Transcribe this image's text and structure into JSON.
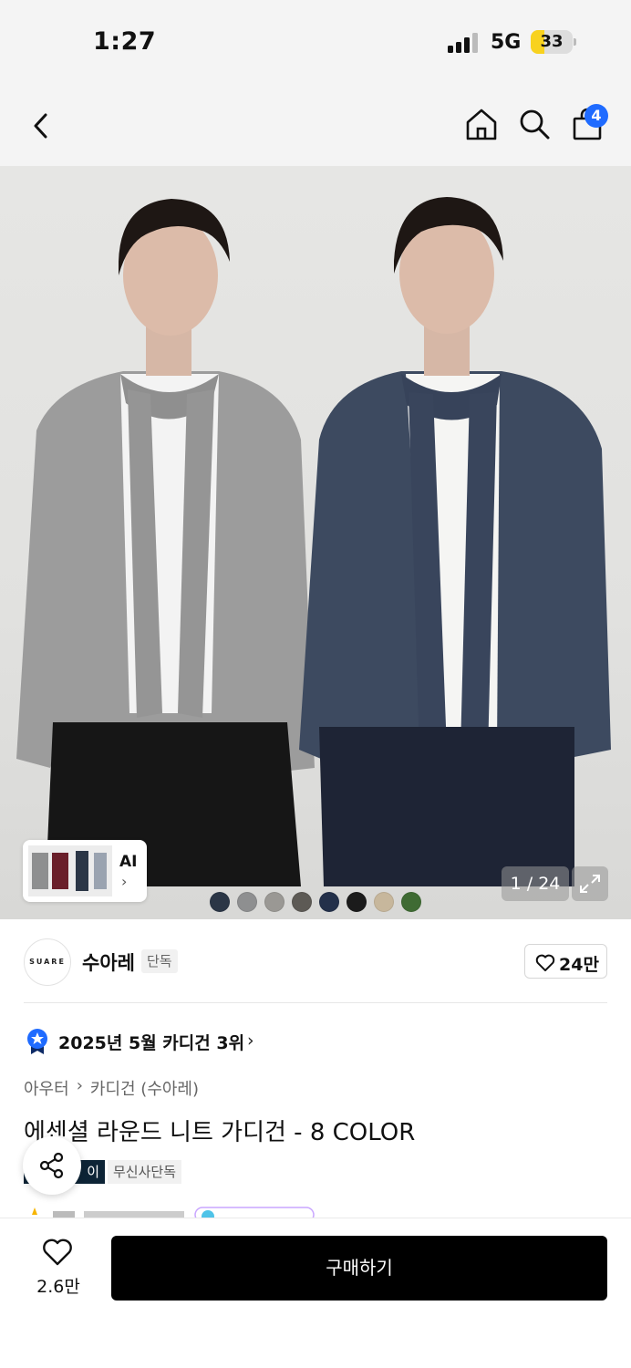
{
  "status_bar": {
    "time": "1:27",
    "network": "5G",
    "battery": "33",
    "battery_level": 0.33
  },
  "nav": {
    "cart_count": "4"
  },
  "gallery": {
    "page_indicator": "1 / 24",
    "ai_label": "AI",
    "swatch_colors": [
      "#2b3646",
      "#8e8f90",
      "#9a9894",
      "#5d5a55",
      "#23304a",
      "#1b1b1b",
      "#c7b79c",
      "#3f6b33"
    ]
  },
  "brand": {
    "logo_text": "SUARE",
    "name": "수아레",
    "tag": "단독",
    "likes": "24만"
  },
  "ranking": {
    "text": "2025년 5월 카디건 3위"
  },
  "breadcrumb": {
    "category": "아우터",
    "subcategory": "카디건 (수아레)"
  },
  "product": {
    "title": "에센셜 라운드 니트 가디건 - 8 COLOR",
    "badge_dark": "이",
    "badge_light": "무신사단독"
  },
  "bottom": {
    "wish_count": "2.6만",
    "buy_label": "구매하기"
  },
  "colors": {
    "accent_blue": "#1f6bff",
    "buy_button": "#000000"
  }
}
